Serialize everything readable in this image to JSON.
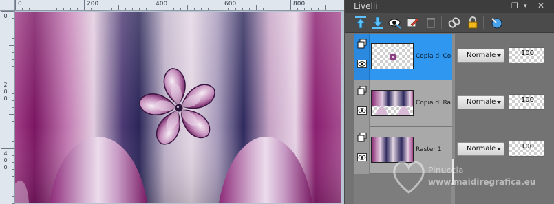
{
  "ruler": {
    "top_labels": [
      "0",
      "200",
      "400",
      "600",
      "800"
    ],
    "left_labels": [
      "0",
      "2",
      "0",
      "0",
      "4",
      "0",
      "0"
    ]
  },
  "panel": {
    "title": "Livelli",
    "header_buttons": [
      "dock-icon",
      "menu-arrow-icon",
      "close-icon"
    ]
  },
  "toolbar": {
    "buttons": [
      "move-layer-up-icon",
      "move-layer-down-icon",
      "visibility-toggle-icon",
      "edit-layer-icon",
      "delete-layer-icon",
      "link-icon",
      "lock-icon",
      "layer-properties-icon"
    ]
  },
  "layers": [
    {
      "name": "Copia di Copia",
      "blend_mode": "Normale",
      "opacity": "100",
      "selected": true
    },
    {
      "name": "Copia di Raster",
      "blend_mode": "Normale",
      "opacity": "100",
      "selected": false
    },
    {
      "name": "Raster 1",
      "blend_mode": "Normale",
      "opacity": "100",
      "selected": false
    }
  ],
  "watermark": {
    "line1": "Pinuccia",
    "line2": "www.maidiregrafica.eu"
  },
  "colors": {
    "selection": "#2f97ef",
    "canvas_purple": "#8a1f6e",
    "canvas_navy": "#2e2a5c",
    "canvas_lilac": "#d9bfd6"
  }
}
